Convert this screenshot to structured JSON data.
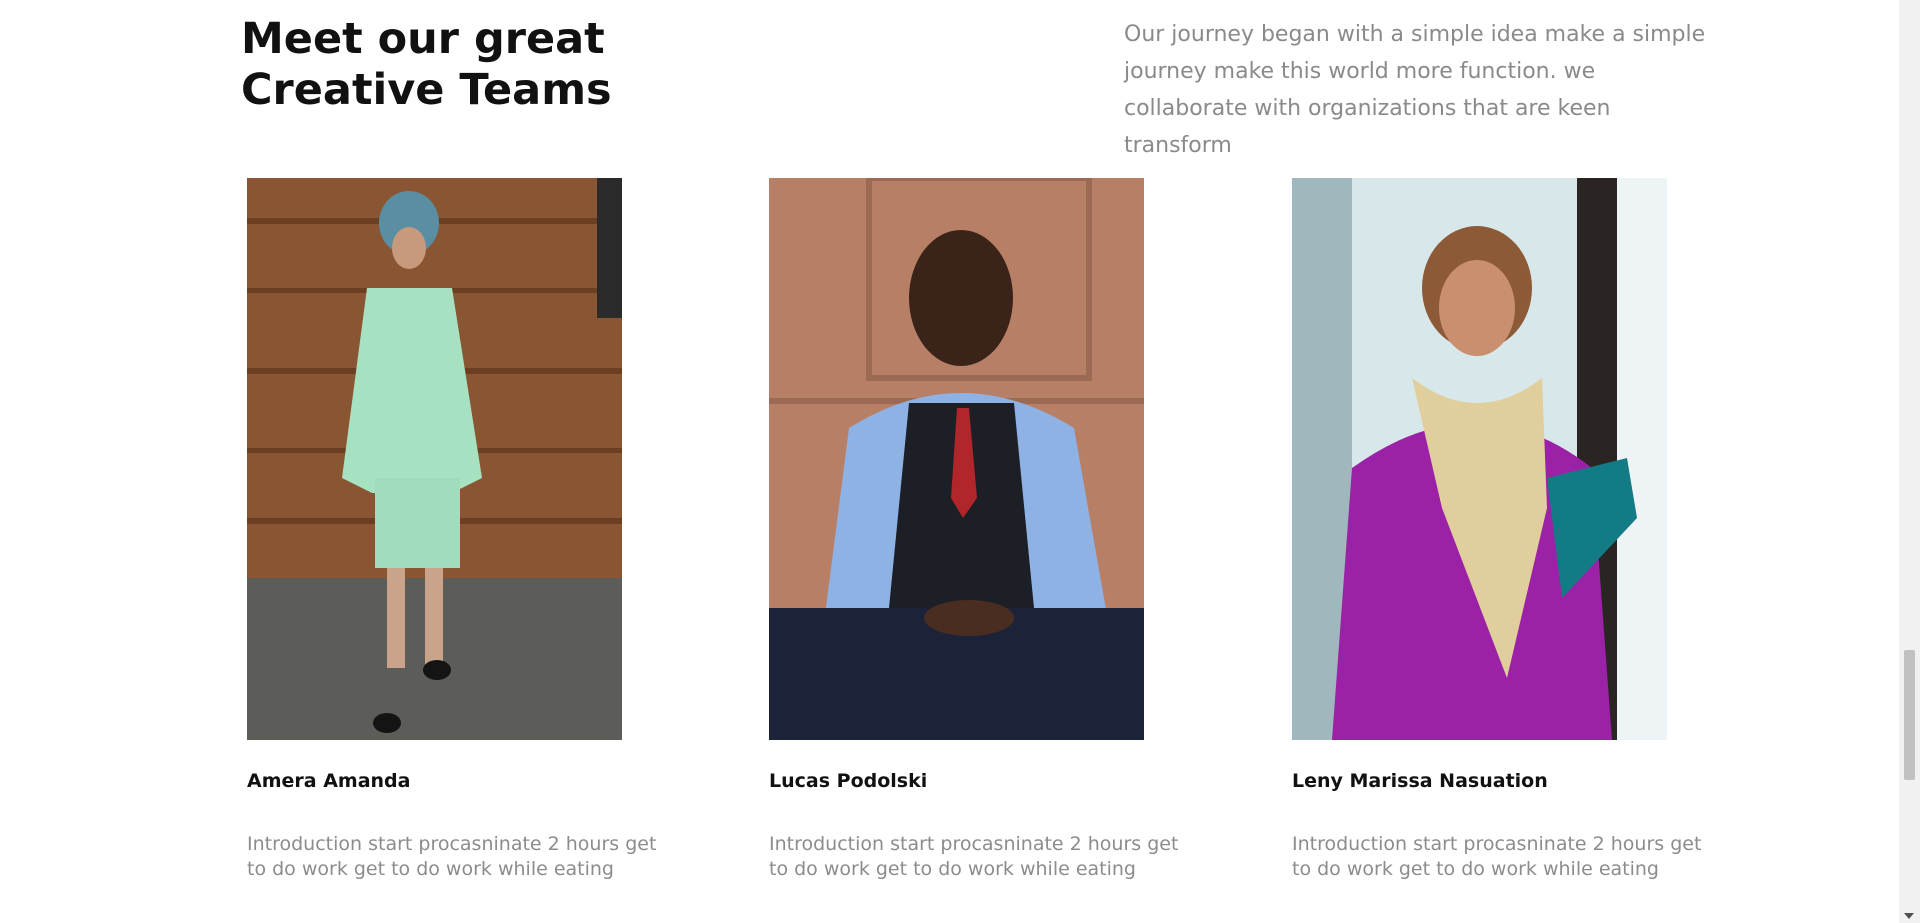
{
  "section": {
    "title": "Meet our great\nCreative Teams",
    "intro": "Our journey began with a simple idea make a simple journey make this world more function. we collaborate with organizations that are keen transform"
  },
  "team": [
    {
      "name": "Amera Amanda",
      "description": "Introduction start procasninate 2 hours get to do work get to do work while eating"
    },
    {
      "name": "Lucas Podolski",
      "description": "Introduction start procasninate 2 hours get to do work get to do work while eating"
    },
    {
      "name": "Leny Marissa Nasuation",
      "description": "Introduction start procasninate 2 hours get to do work get to do work while eating"
    }
  ]
}
